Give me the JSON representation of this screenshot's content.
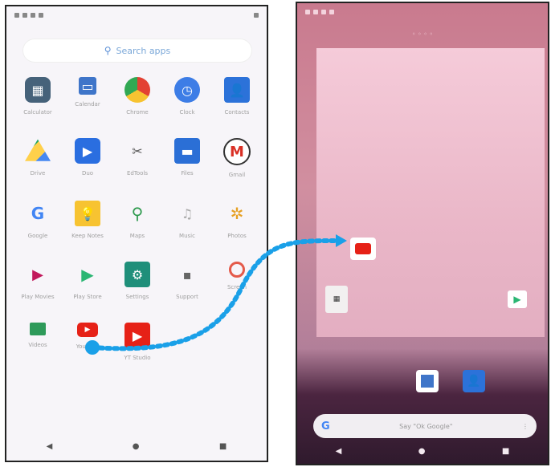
{
  "left": {
    "search_label": "Search apps",
    "apps": [
      {
        "label": "Calculator",
        "icon": "calculator-icon",
        "glyph": "▦",
        "cls": "ic-calc"
      },
      {
        "label": "Calendar",
        "icon": "calendar-icon",
        "glyph": "▭",
        "cls": "ic-cal"
      },
      {
        "label": "Chrome",
        "icon": "chrome-icon",
        "glyph": "",
        "cls": "ic-chrome"
      },
      {
        "label": "Clock",
        "icon": "clock-icon",
        "glyph": "◷",
        "cls": "ic-clock"
      },
      {
        "label": "Contacts",
        "icon": "contacts-icon",
        "glyph": "👤",
        "cls": "ic-contacts"
      },
      {
        "label": "Drive",
        "icon": "drive-icon",
        "glyph": "",
        "cls": "ic-drive"
      },
      {
        "label": "Duo",
        "icon": "duo-icon",
        "glyph": "▶",
        "cls": "ic-duo"
      },
      {
        "label": "EdTools",
        "icon": "tools-icon",
        "glyph": "✂",
        "cls": "ic-tools"
      },
      {
        "label": "Files",
        "icon": "files-icon",
        "glyph": "▬",
        "cls": "ic-files"
      },
      {
        "label": "Gmail",
        "icon": "gmail-icon",
        "glyph": "M",
        "cls": "ic-gmail"
      },
      {
        "label": "Google",
        "icon": "google-icon",
        "glyph": "G",
        "cls": "ic-google"
      },
      {
        "label": "Keep Notes",
        "icon": "keep-icon",
        "glyph": "💡",
        "cls": "ic-keep"
      },
      {
        "label": "Maps",
        "icon": "maps-icon",
        "glyph": "⚲",
        "cls": "ic-maps"
      },
      {
        "label": "Music",
        "icon": "music-icon",
        "glyph": "♫",
        "cls": "ic-music"
      },
      {
        "label": "Photos",
        "icon": "photos-icon",
        "glyph": "✲",
        "cls": "ic-photos"
      },
      {
        "label": "Play Movies",
        "icon": "play-movies-icon",
        "glyph": "▶",
        "cls": "ic-movies"
      },
      {
        "label": "Play Store",
        "icon": "play-store-icon",
        "glyph": "▶",
        "cls": "ic-play"
      },
      {
        "label": "Settings",
        "icon": "settings-icon",
        "glyph": "⚙",
        "cls": "ic-settings"
      },
      {
        "label": "Support",
        "icon": "support-icon",
        "glyph": "▪",
        "cls": "ic-support"
      },
      {
        "label": "Screen",
        "icon": "screen-record-icon",
        "glyph": "",
        "cls": "ic-screen"
      },
      {
        "label": "Videos",
        "icon": "videos-icon",
        "glyph": "",
        "cls": "ic-videos"
      },
      {
        "label": "YouTube",
        "icon": "youtube-icon",
        "glyph": "▶",
        "cls": "ic-youtube"
      },
      {
        "label": "YT Studio",
        "icon": "yt-studio-icon",
        "glyph": "▶",
        "cls": "ic-ytstudio"
      }
    ],
    "nav": {
      "back": "◀",
      "home": "●",
      "recents": "■"
    }
  },
  "right": {
    "top_text": "◦ ◦ ◦ ◦",
    "widget_title": "",
    "gbar_text": "Say \"Ok Google\"",
    "gbar_mic": "⋮",
    "gbar_logo": "G",
    "nav": {
      "back": "◀",
      "home": "●",
      "recents": "■"
    }
  },
  "colors": {
    "drag_arrow": "#1aa0e8",
    "youtube": "#e62117"
  }
}
